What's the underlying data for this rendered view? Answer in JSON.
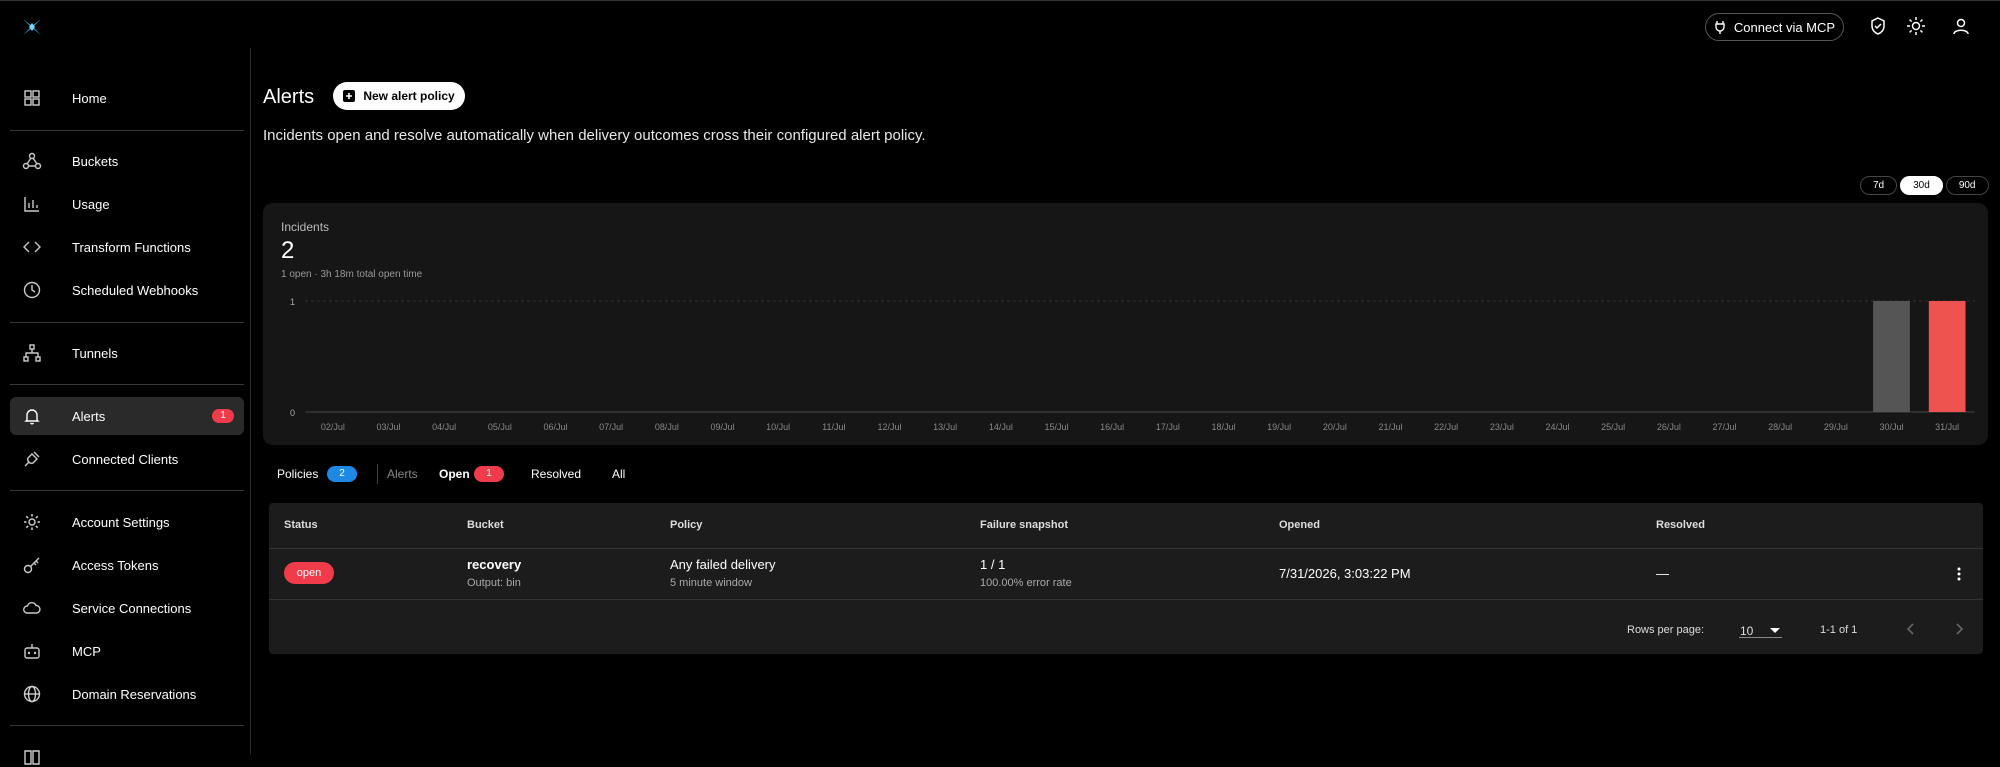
{
  "header": {
    "mcp_label": "Connect via MCP"
  },
  "sidebar": {
    "items": [
      {
        "label": "Home",
        "icon": "grid-icon"
      },
      {
        "label": "Buckets",
        "icon": "webhook-icon"
      },
      {
        "label": "Usage",
        "icon": "bar-chart-icon"
      },
      {
        "label": "Transform Functions",
        "icon": "code-icon"
      },
      {
        "label": "Scheduled Webhooks",
        "icon": "clock-icon"
      },
      {
        "label": "Tunnels",
        "icon": "network-icon"
      },
      {
        "label": "Alerts",
        "icon": "bell-icon",
        "badge": "1",
        "active": true
      },
      {
        "label": "Connected Clients",
        "icon": "plug-icon"
      },
      {
        "label": "Account Settings",
        "icon": "gear-icon"
      },
      {
        "label": "Access Tokens",
        "icon": "key-icon"
      },
      {
        "label": "Service Connections",
        "icon": "cloud-icon"
      },
      {
        "label": "MCP",
        "icon": "robot-icon"
      },
      {
        "label": "Domain Reservations",
        "icon": "globe-icon"
      }
    ]
  },
  "page": {
    "title": "Alerts",
    "new_policy_label": "New alert policy",
    "subtitle": "Incidents open and resolve automatically when delivery outcomes cross their configured alert policy."
  },
  "range": {
    "options": [
      "7d",
      "30d",
      "90d"
    ],
    "selected": "30d"
  },
  "summary": {
    "label": "Incidents",
    "value": "2",
    "detail": "1 open · 3h 18m total open time"
  },
  "chart_data": {
    "type": "bar",
    "categories": [
      "02/Jul",
      "03/Jul",
      "04/Jul",
      "05/Jul",
      "06/Jul",
      "07/Jul",
      "08/Jul",
      "09/Jul",
      "10/Jul",
      "11/Jul",
      "12/Jul",
      "13/Jul",
      "14/Jul",
      "15/Jul",
      "16/Jul",
      "17/Jul",
      "18/Jul",
      "19/Jul",
      "20/Jul",
      "21/Jul",
      "22/Jul",
      "23/Jul",
      "24/Jul",
      "25/Jul",
      "26/Jul",
      "27/Jul",
      "28/Jul",
      "29/Jul",
      "30/Jul",
      "31/Jul"
    ],
    "values": [
      0,
      0,
      0,
      0,
      0,
      0,
      0,
      0,
      0,
      0,
      0,
      0,
      0,
      0,
      0,
      0,
      0,
      0,
      0,
      0,
      0,
      0,
      0,
      0,
      0,
      0,
      0,
      0,
      1,
      1
    ],
    "bar_colors": [
      "#555555",
      "#ef5350"
    ],
    "ylim": [
      0,
      1
    ],
    "yticks": [
      "0",
      "1"
    ]
  },
  "tabs": {
    "policies": "Policies",
    "policies_count": "2",
    "alerts": "Alerts",
    "open": "Open",
    "open_count": "1",
    "resolved": "Resolved",
    "all": "All"
  },
  "table": {
    "headers": [
      "Status",
      "Bucket",
      "Policy",
      "Failure snapshot",
      "Opened",
      "Resolved"
    ],
    "row": {
      "status": "open",
      "bucket": "recovery",
      "bucket_sub": "Output: bin",
      "policy": "Any failed delivery",
      "policy_sub": "5 minute window",
      "snapshot": "1 / 1",
      "snapshot_sub": "100.00% error rate",
      "opened": "7/31/2026, 3:03:22 PM",
      "resolved": "—"
    },
    "rows_per_page_label": "Rows per page:",
    "rows_per_page": "10",
    "pagination": "1-1 of 1"
  },
  "colors": {
    "accent": "#1e88e5",
    "alert": "#ef3b4a"
  }
}
